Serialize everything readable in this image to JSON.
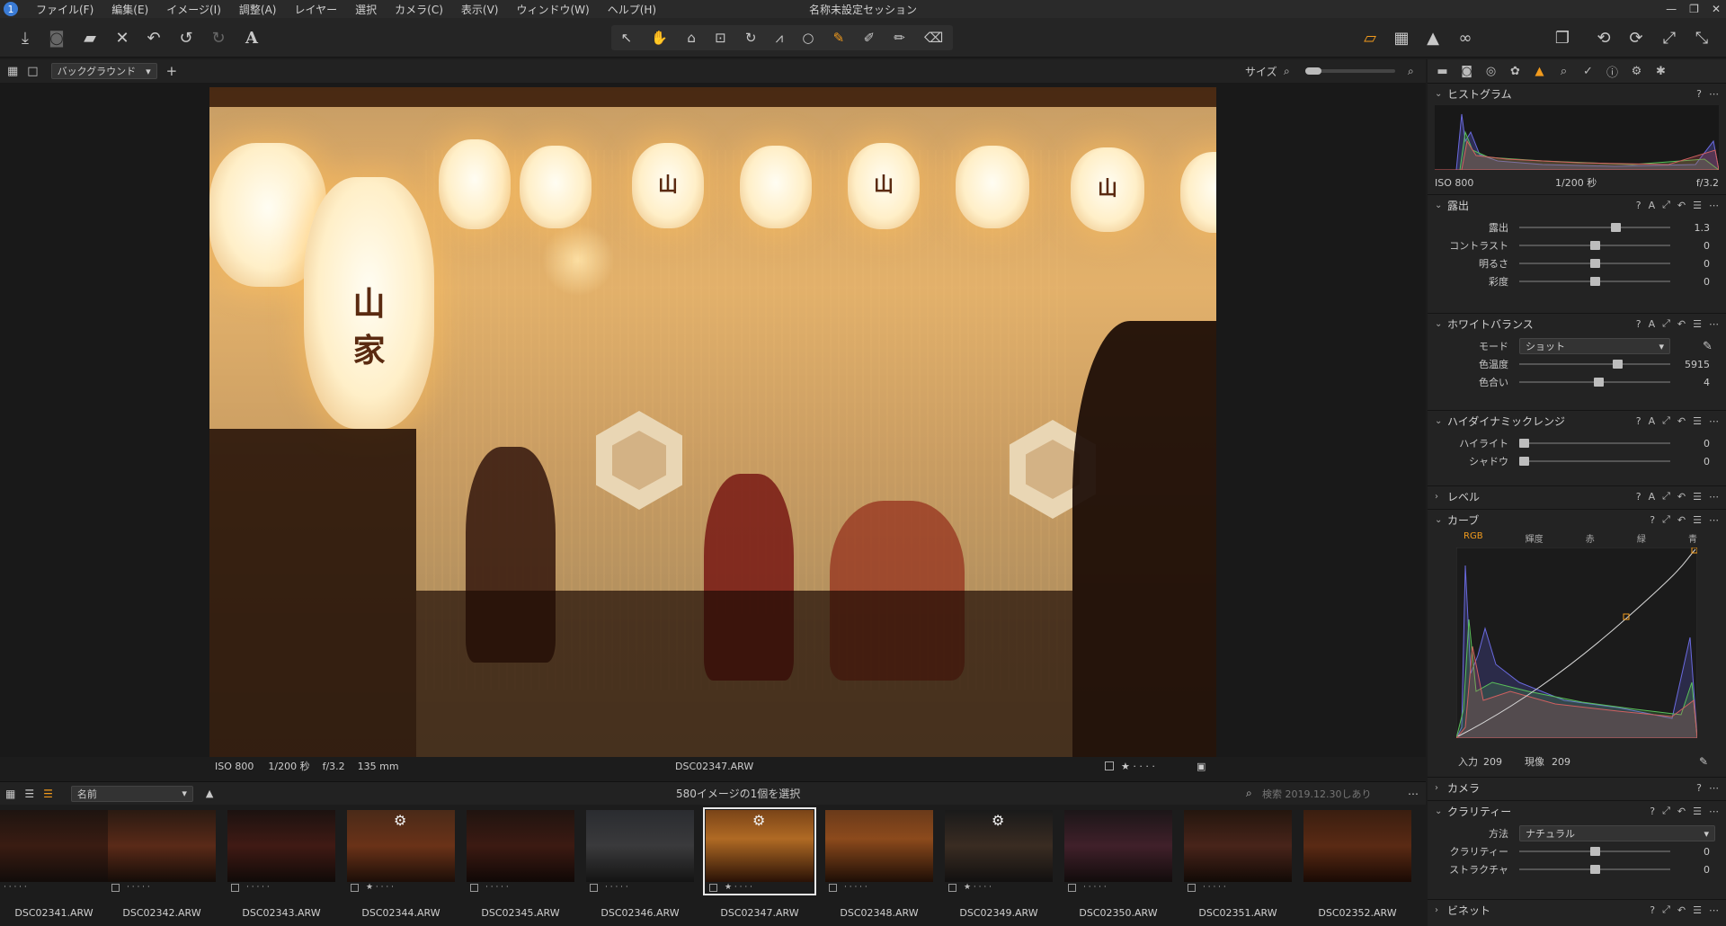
{
  "app": {
    "title": "名称未設定セッション",
    "menu": [
      "ファイル(F)",
      "編集(E)",
      "イメージ(I)",
      "調整(A)",
      "レイヤー",
      "選択",
      "カメラ(C)",
      "表示(V)",
      "ウィンドウ(W)",
      "ヘルプ(H)"
    ]
  },
  "viewer_header": {
    "background_select": "バックグラウンド",
    "size_label": "サイズ"
  },
  "photo_info": {
    "iso": "ISO 800",
    "shutter": "1/200 秒",
    "aperture": "f/3.2",
    "focal": "135 mm",
    "filename": "DSC02347.ARW"
  },
  "browser": {
    "sort_select": "名前",
    "selection_status": "580イメージの1個を選択",
    "search_placeholder": "検索 2019.12.30しあり",
    "thumbnails": [
      {
        "name": "DSC02341.ARW",
        "selected": false
      },
      {
        "name": "DSC02342.ARW",
        "selected": false
      },
      {
        "name": "DSC02343.ARW",
        "selected": false
      },
      {
        "name": "DSC02344.ARW",
        "selected": false
      },
      {
        "name": "DSC02345.ARW",
        "selected": false
      },
      {
        "name": "DSC02346.ARW",
        "selected": false
      },
      {
        "name": "DSC02347.ARW",
        "selected": true
      },
      {
        "name": "DSC02348.ARW",
        "selected": false
      },
      {
        "name": "DSC02349.ARW",
        "selected": false
      },
      {
        "name": "DSC02350.ARW",
        "selected": false
      },
      {
        "name": "DSC02351.ARW",
        "selected": false
      },
      {
        "name": "DSC02352.ARW",
        "selected": false
      }
    ]
  },
  "panel": {
    "histogram": {
      "title": "ヒストグラム",
      "iso": "ISO 800",
      "shutter": "1/200 秒",
      "aperture": "f/3.2"
    },
    "exposure": {
      "title": "露出",
      "rows": [
        {
          "label": "露出",
          "value": "1.3",
          "level": 0.65
        },
        {
          "label": "コントラスト",
          "value": "0",
          "level": 0.5
        },
        {
          "label": "明るさ",
          "value": "0",
          "level": 0.5
        },
        {
          "label": "彩度",
          "value": "0",
          "level": 0.5
        }
      ]
    },
    "white_balance": {
      "title": "ホワイトバランス",
      "mode_label": "モード",
      "mode_value": "ショット",
      "rows": [
        {
          "label": "色温度",
          "value": "5915",
          "level": 0.66
        },
        {
          "label": "色合い",
          "value": "4",
          "level": 0.53
        }
      ]
    },
    "hdr": {
      "title": "ハイダイナミックレンジ",
      "rows": [
        {
          "label": "ハイライト",
          "value": "0",
          "level": 0.0
        },
        {
          "label": "シャドウ",
          "value": "0",
          "level": 0.0
        }
      ]
    },
    "levels": {
      "title": "レベル"
    },
    "curve": {
      "title": "カーブ",
      "tabs": [
        "RGB",
        "輝度",
        "赤",
        "緑",
        "青"
      ],
      "input_label": "入力",
      "input_value": "209",
      "output_label": "現像",
      "output_value": "209"
    },
    "camera": {
      "title": "カメラ"
    },
    "clarity": {
      "title": "クラリティー",
      "method_label": "方法",
      "method_value": "ナチュラル",
      "rows": [
        {
          "label": "クラリティー",
          "value": "0",
          "level": 0.5
        },
        {
          "label": "ストラクチャ",
          "value": "0",
          "level": 0.5
        }
      ]
    },
    "vignette": {
      "title": "ビネット"
    }
  },
  "colors": {
    "accent": "#f29b1d",
    "panel_bg": "#232323",
    "viewer_bg": "#191919"
  }
}
